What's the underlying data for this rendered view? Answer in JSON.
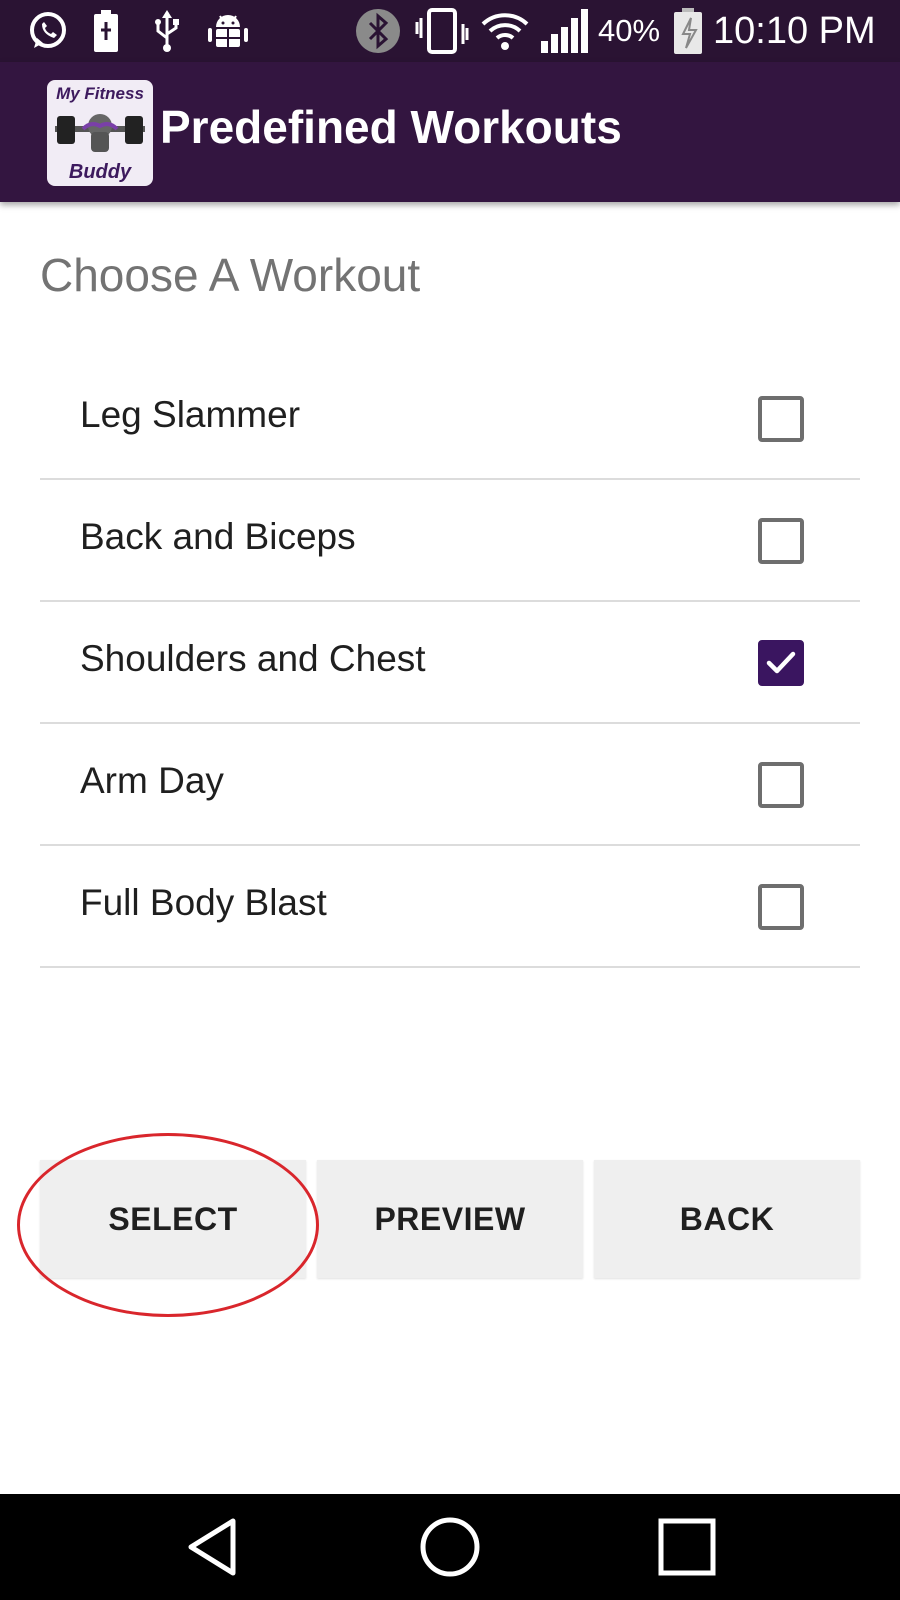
{
  "status_bar": {
    "battery_percent": "40%",
    "time": "10:10 PM",
    "icons": [
      "whatsapp-icon",
      "battery-full-icon",
      "usb-icon",
      "android-debug-icon",
      "bluetooth-icon",
      "vibrate-icon",
      "wifi-icon",
      "signal-icon",
      "battery-charging-icon"
    ]
  },
  "app_bar": {
    "logo_text_top": "My Fitness",
    "logo_text_bottom": "Buddy",
    "title": "Predefined Workouts",
    "color": "#331540"
  },
  "main": {
    "heading": "Choose A Workout",
    "workouts": [
      {
        "label": "Leg Slammer",
        "checked": false
      },
      {
        "label": "Back and Biceps",
        "checked": false
      },
      {
        "label": "Shoulders and Chest",
        "checked": true
      },
      {
        "label": "Arm Day",
        "checked": false
      },
      {
        "label": "Full Body Blast",
        "checked": false
      }
    ]
  },
  "buttons": {
    "select": "SELECT",
    "preview": "PREVIEW",
    "back": "BACK"
  },
  "annotation": {
    "target": "select-button",
    "color": "#d9262c"
  },
  "nav_bar": {
    "icons": [
      "back-triangle-icon",
      "home-circle-icon",
      "recents-square-icon"
    ]
  },
  "colors": {
    "accent": "#3a1560",
    "status_bar": "#2a1333"
  }
}
